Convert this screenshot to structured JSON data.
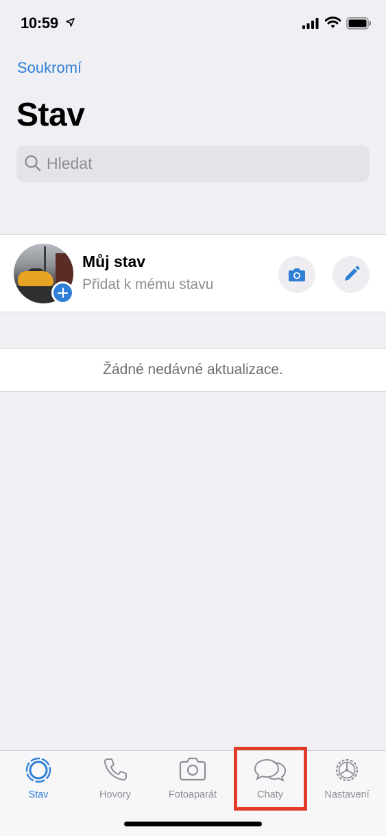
{
  "status_bar": {
    "time": "10:59"
  },
  "nav": {
    "back_label": "Soukromí"
  },
  "page": {
    "title": "Stav"
  },
  "search": {
    "placeholder": "Hledat"
  },
  "my_status": {
    "name": "Můj stav",
    "subtitle": "Přidat k mému stavu"
  },
  "empty_message": "Žádné nedávné aktualizace.",
  "tabs": [
    {
      "label": "Stav",
      "icon": "status-icon",
      "active": true
    },
    {
      "label": "Hovory",
      "icon": "phone-icon",
      "active": false
    },
    {
      "label": "Fotoaparát",
      "icon": "camera-icon",
      "active": false
    },
    {
      "label": "Chaty",
      "icon": "chat-bubbles-icon",
      "active": false,
      "highlighted": true
    },
    {
      "label": "Nastavení",
      "icon": "gear-icon",
      "active": false
    }
  ],
  "colors": {
    "accent": "#2f7fd6",
    "background": "#efeff4",
    "highlight": "#e23b2a",
    "secondary_text": "#8e8e93"
  }
}
